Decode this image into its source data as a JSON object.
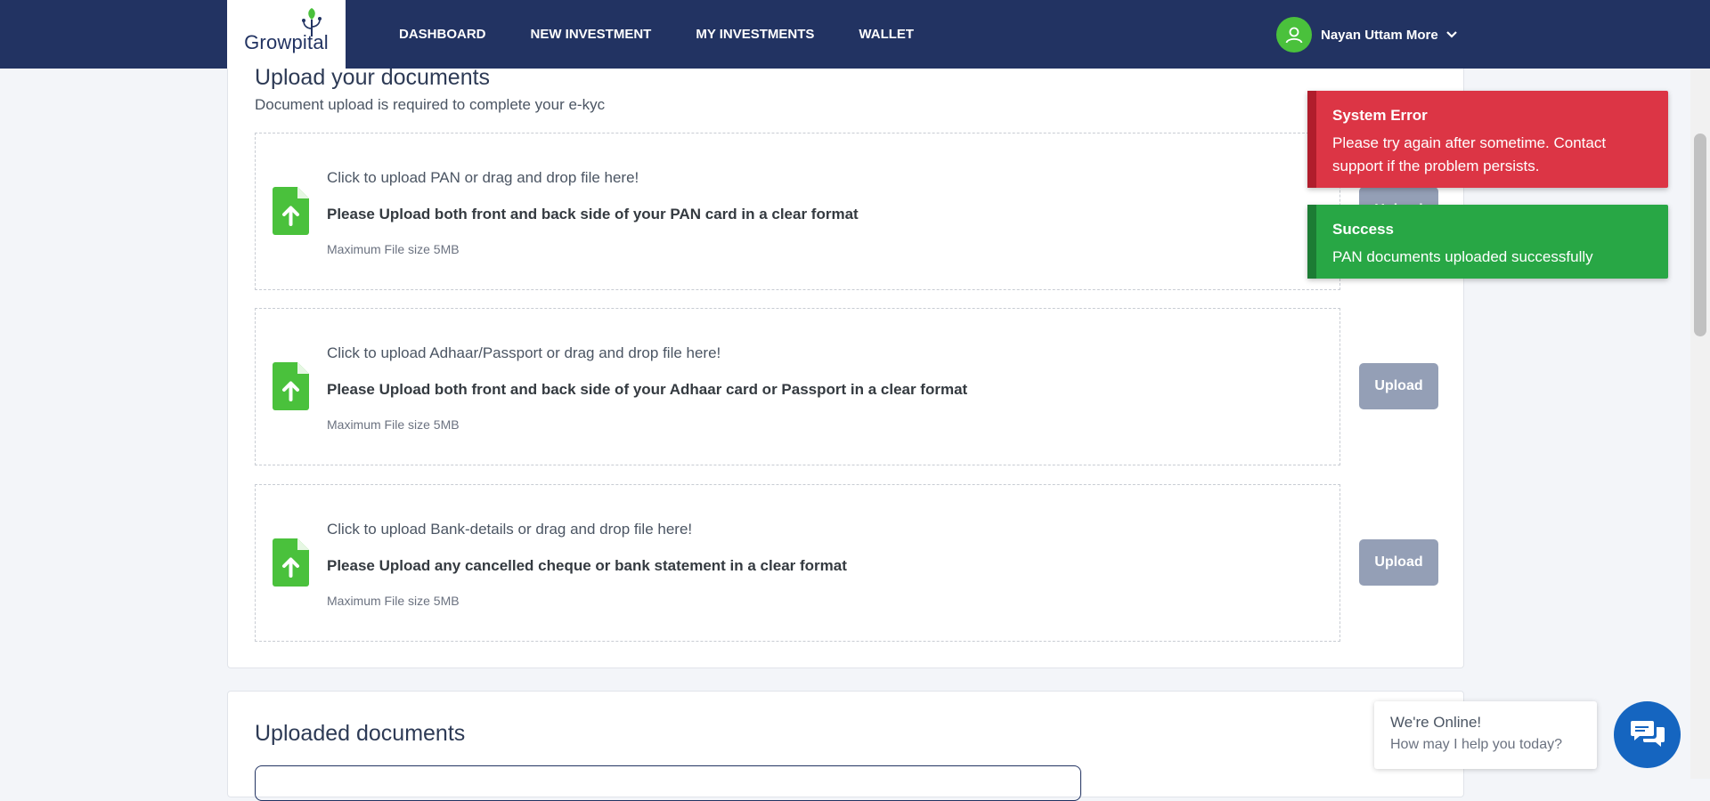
{
  "header": {
    "logo_text": "Growpital",
    "nav": [
      "DASHBOARD",
      "NEW INVESTMENT",
      "MY INVESTMENTS",
      "WALLET"
    ],
    "user_name": "Nayan Uttam More",
    "user_icon": "user-avatar-icon",
    "dropdown_icon": "chevron-down-icon"
  },
  "upload_section": {
    "title": "Upload your documents",
    "subtitle": "Document upload is required to complete your e-kyc",
    "rows": [
      {
        "line1": "Click to upload PAN or drag and drop file here!",
        "line2": "Please Upload both front and back side of your PAN card in a clear format",
        "line3": "Maximum File size 5MB",
        "button": "Upload"
      },
      {
        "line1": "Click to upload Adhaar/Passport or drag and drop file here!",
        "line2": "Please Upload both front and back side of your Adhaar card or Passport in a clear format",
        "line3": "Maximum File size 5MB",
        "button": "Upload"
      },
      {
        "line1": "Click to upload Bank-details or drag and drop file here!",
        "line2": "Please Upload any cancelled cheque or bank statement in a clear format",
        "line3": "Maximum File size 5MB",
        "button": "Upload"
      }
    ]
  },
  "uploaded_section": {
    "title": "Uploaded documents"
  },
  "toasts": {
    "error": {
      "title": "System Error",
      "message": "Please try again after sometime. Contact support if the problem persists."
    },
    "success": {
      "title": "Success",
      "message": "PAN documents uploaded successfully"
    }
  },
  "chat": {
    "online": "We're Online!",
    "help": "How may I help you today?"
  },
  "colors": {
    "header_bg": "#223362",
    "upload_icon": "#4ac13c",
    "error": "#dc3545",
    "success": "#28a745",
    "chat": "#1565c0"
  }
}
